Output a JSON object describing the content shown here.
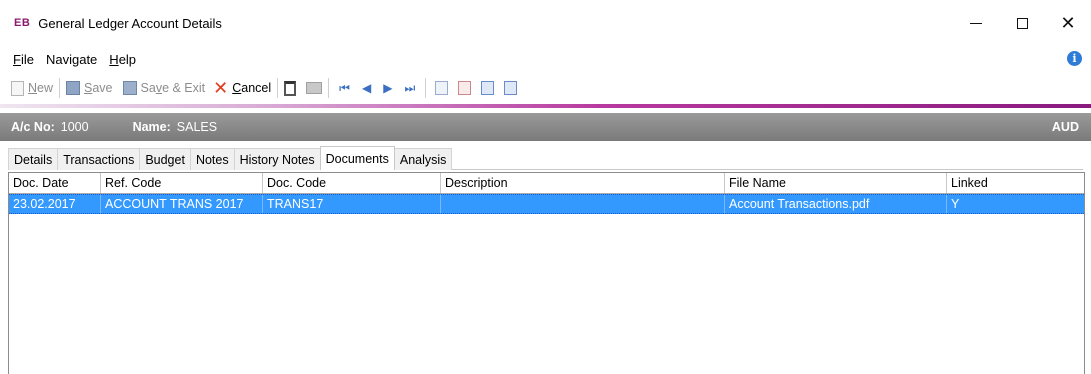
{
  "window": {
    "logo": "EB",
    "title": "General Ledger Account Details",
    "controls": {
      "minimize": "minimize",
      "maximize": "maximize",
      "close": "✕"
    }
  },
  "menu": [
    {
      "label_pre": "",
      "accel": "F",
      "label_post": "ile"
    },
    {
      "label_pre": "Navi",
      "accel": "g",
      "label_post": "ate"
    },
    {
      "label_pre": "",
      "accel": "H",
      "label_post": "elp"
    }
  ],
  "toolbar": {
    "new_accel": "N",
    "new_rest": "ew",
    "save_accel": "S",
    "save_rest": "ave",
    "save_exit_pre": "Sa",
    "save_exit_accel": "v",
    "save_exit_rest": "e & Exit",
    "cancel_accel": "C",
    "cancel_rest": "ancel"
  },
  "account": {
    "number_label": "A/c No:",
    "number": "1000",
    "name_label": "Name:",
    "name": "SALES",
    "currency": "AUD"
  },
  "tabs": [
    "Details",
    "Transactions",
    "Budget",
    "Notes",
    "History Notes",
    "Documents",
    "Analysis"
  ],
  "active_tab": "Documents",
  "grid": {
    "columns": [
      "Doc. Date",
      "Ref. Code",
      "Doc. Code",
      "Description",
      "File Name",
      "Linked"
    ],
    "rows": [
      [
        "23.02.2017",
        "ACCOUNT TRANS 2017",
        "TRANS17",
        "",
        "Account Transactions.pdf",
        "Y"
      ]
    ]
  },
  "colors": {
    "accent": "#8a1a7e",
    "selection": "#3399ff",
    "header_bar": "#8a8a8a"
  }
}
